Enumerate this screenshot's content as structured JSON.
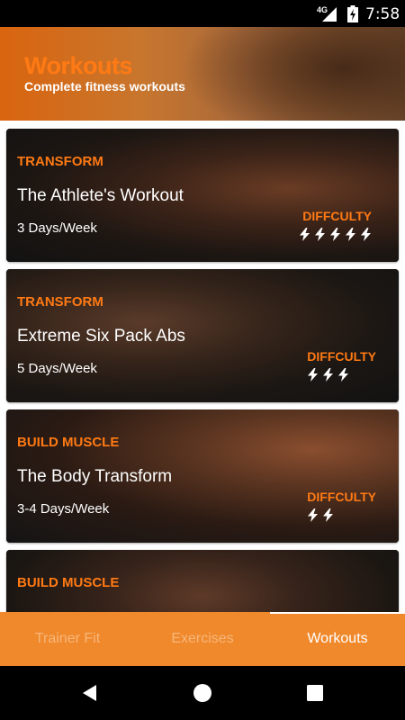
{
  "status_bar": {
    "network": "4G",
    "time": "7:58"
  },
  "header": {
    "title": "Workouts",
    "subtitle": "Complete fitness workouts"
  },
  "workouts": [
    {
      "category": "TRANSFORM",
      "name": "The Athlete's Workout",
      "frequency": "3 Days/Week",
      "difficulty_label": "DIFFCULTY",
      "difficulty_level": 5
    },
    {
      "category": "TRANSFORM",
      "name": "Extreme Six Pack Abs",
      "frequency": "5 Days/Week",
      "difficulty_label": "DIFFCULTY",
      "difficulty_level": 3
    },
    {
      "category": "BUILD MUSCLE",
      "name": "The Body Transform",
      "frequency": "3-4 Days/Week",
      "difficulty_label": "DIFFCULTY",
      "difficulty_level": 2
    },
    {
      "category": "BUILD MUSCLE"
    }
  ],
  "tabs": [
    {
      "label": "Trainer Fit"
    },
    {
      "label": "Exercises"
    },
    {
      "label": "Workouts"
    }
  ],
  "colors": {
    "accent": "#ff7a14",
    "tab_bar": "#f0892c"
  },
  "icons": {
    "difficulty": "lightning-bolt-icon",
    "back": "back-triangle-icon",
    "home": "home-circle-icon",
    "recents": "recents-square-icon"
  }
}
